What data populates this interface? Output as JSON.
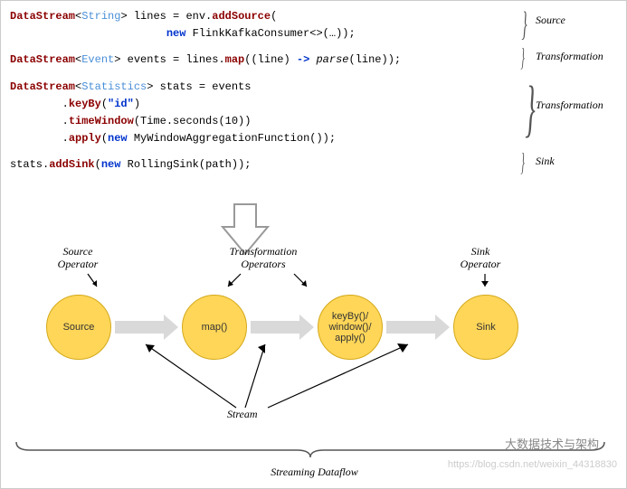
{
  "code": {
    "l1_a": "DataStream",
    "l1_b": "String",
    "l1_c": "> lines = env.",
    "l1_d": "addSource",
    "l1_e": "(",
    "l2_a": "                        ",
    "l2_b": "new",
    "l2_c": " FlinkKafkaConsumer<>(…));",
    "l3_a": "DataStream",
    "l3_b": "Event",
    "l3_c": "> events = lines.",
    "l3_d": "map",
    "l3_e": "((line) ",
    "l3_f": "->",
    "l3_g": " ",
    "l3_h": "parse",
    "l3_i": "(line));",
    "l4_a": "DataStream",
    "l4_b": "Statistics",
    "l4_c": "> stats = events",
    "l5_a": "        .",
    "l5_b": "keyBy",
    "l5_c": "(",
    "l5_d": "\"id\"",
    "l5_e": ")",
    "l6_a": "        .",
    "l6_b": "timeWindow",
    "l6_c": "(Time.seconds(10))",
    "l7_a": "        .",
    "l7_b": "apply",
    "l7_c": "(",
    "l7_d": "new",
    "l7_e": " MyWindowAggregationFunction());",
    "l8_a": "stats.",
    "l8_b": "addSink",
    "l8_c": "(",
    "l8_d": "new",
    "l8_e": " RollingSink(path));"
  },
  "right": {
    "source": "Source",
    "trans1": "Transformation",
    "trans2": "Transformation",
    "sink": "Sink"
  },
  "nodes": {
    "source": "Source",
    "map": "map()",
    "kwa": "keyBy()/\nwindow()/\napply()",
    "sink": "Sink"
  },
  "labels": {
    "sourceOp": "Source\nOperator",
    "transOps": "Transformation\nOperators",
    "sinkOp": "Sink\nOperator",
    "stream": "Stream",
    "dataflow": "Streaming Dataflow"
  },
  "watermarks": {
    "w1": "大数据技术与架构",
    "w2": "https://blog.csdn.net/weixin_44318830"
  }
}
